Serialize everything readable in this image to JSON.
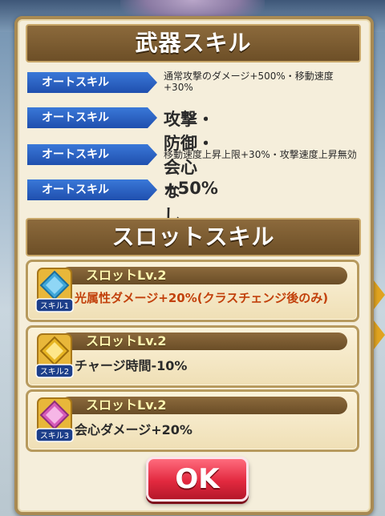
{
  "weapon_skill_header": "武器スキル",
  "auto_skills": [
    {
      "tag": "オートスキル",
      "desc": "通常攻撃のダメージ+500%・移動速度+30%"
    },
    {
      "tag": "オートスキル",
      "desc": "攻撃・防御・会心+50%"
    },
    {
      "tag": "オートスキル",
      "desc": "移動速度上昇上限+30%・攻撃速度上昇無効"
    },
    {
      "tag": "オートスキル",
      "desc": "なし"
    }
  ],
  "slot_skill_header": "スロットスキル",
  "slots": [
    {
      "icon_label": "スキル1",
      "level": "スロットLv.2",
      "desc": "光属性ダメージ+20%(クラスチェンジ後のみ)",
      "desc_color": "#c2410c",
      "gem_color": "#3fa7d9"
    },
    {
      "icon_label": "スキル2",
      "level": "スロットLv.2",
      "desc": "チャージ時間-10%",
      "desc_color": "#2a2a2a",
      "gem_color": "#e6b422"
    },
    {
      "icon_label": "スキル3",
      "level": "スロットLv.2",
      "desc": "会心ダメージ+20%",
      "desc_color": "#2a2a2a",
      "gem_color": "#d65bb8"
    }
  ],
  "ok_button": "OK"
}
